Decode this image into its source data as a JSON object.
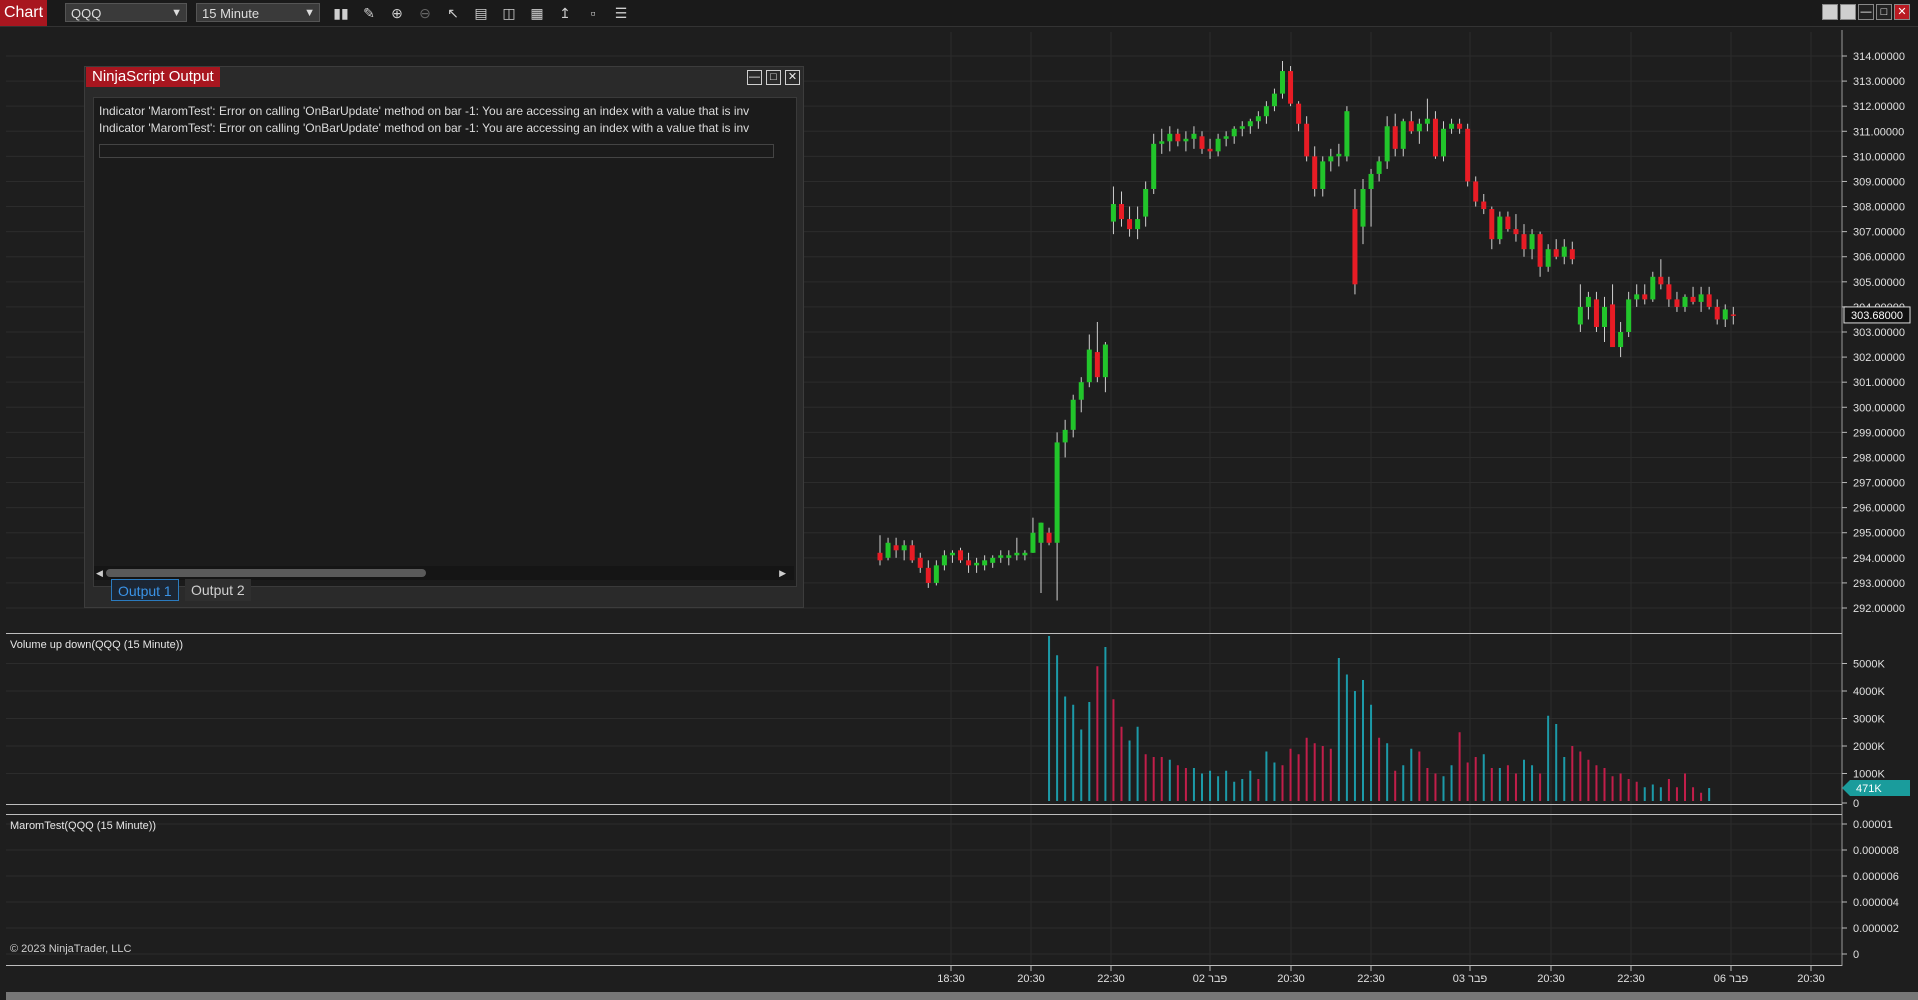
{
  "toolbar": {
    "chart_label": "Chart",
    "instrument": "QQQ",
    "interval": "15 Minute"
  },
  "colors": {
    "accent_red": "#a8161f",
    "candle_up": "#22c52b",
    "candle_down": "#e81c25",
    "volume_up": "#1c9aa8",
    "volume_down": "#c21e4a",
    "grid": "#2c2c2c",
    "background": "#1e1e1e"
  },
  "ninjascript": {
    "title": "NinjaScript Output",
    "lines": [
      "Indicator 'MaromTest': Error on calling 'OnBarUpdate' method on bar -1: You are accessing an index with a value that is invali",
      "Indicator 'MaromTest': Error on calling 'OnBarUpdate' method on bar -1: You are accessing an index with a value that is invali"
    ],
    "tabs": [
      {
        "label": "Output 1",
        "active": true
      },
      {
        "label": "Output 2",
        "active": false
      }
    ]
  },
  "panels": {
    "volume_label": "Volume up down(QQQ (15 Minute))",
    "indicator_label": "MaromTest(QQQ (15 Minute))",
    "copyright": "© 2023 NinjaTrader, LLC"
  },
  "price_axis": {
    "ticks": [
      "314.00000",
      "313.00000",
      "312.00000",
      "311.00000",
      "310.00000",
      "309.00000",
      "308.00000",
      "307.00000",
      "306.00000",
      "305.00000",
      "304.00000",
      "303.00000",
      "302.00000",
      "301.00000",
      "300.00000",
      "299.00000",
      "298.00000",
      "297.00000",
      "296.00000",
      "295.00000",
      "294.00000",
      "293.00000",
      "292.00000"
    ],
    "current_price": "303.68000"
  },
  "volume_axis": {
    "ticks": [
      "5000K",
      "4000K",
      "3000K",
      "2000K",
      "1000K",
      "0"
    ],
    "current": "471K"
  },
  "indicator_axis": {
    "ticks": [
      "0.00001",
      "0.000008",
      "0.000006",
      "0.000004",
      "0.000002",
      "0"
    ]
  },
  "time_axis": {
    "labels": [
      "18:30",
      "20:30",
      "22:30",
      "02 פבר",
      "20:30",
      "22:30",
      "03 פבר",
      "20:30",
      "22:30",
      "06 פבר",
      "20:30"
    ]
  },
  "chart_data": {
    "type": "candlestick",
    "ylim": [
      291.5,
      314.5
    ],
    "candles": [
      {
        "o": 294.2,
        "h": 294.9,
        "l": 293.7,
        "c": 293.9
      },
      {
        "o": 294.0,
        "h": 294.8,
        "l": 293.9,
        "c": 294.6
      },
      {
        "o": 294.5,
        "h": 294.8,
        "l": 294.0,
        "c": 294.3
      },
      {
        "o": 294.3,
        "h": 294.7,
        "l": 293.9,
        "c": 294.5
      },
      {
        "o": 294.5,
        "h": 294.7,
        "l": 293.8,
        "c": 293.9
      },
      {
        "o": 294.0,
        "h": 294.2,
        "l": 293.4,
        "c": 293.6
      },
      {
        "o": 293.6,
        "h": 293.9,
        "l": 292.8,
        "c": 293.0
      },
      {
        "o": 293.0,
        "h": 293.9,
        "l": 292.9,
        "c": 293.7
      },
      {
        "o": 293.7,
        "h": 294.3,
        "l": 293.5,
        "c": 294.1
      },
      {
        "o": 294.1,
        "h": 294.3,
        "l": 293.8,
        "c": 294.2
      },
      {
        "o": 294.3,
        "h": 294.4,
        "l": 293.8,
        "c": 293.9
      },
      {
        "o": 293.9,
        "h": 294.2,
        "l": 293.4,
        "c": 293.7
      },
      {
        "o": 293.7,
        "h": 294.0,
        "l": 293.4,
        "c": 293.8
      },
      {
        "o": 293.7,
        "h": 294.1,
        "l": 293.5,
        "c": 293.9
      },
      {
        "o": 293.8,
        "h": 294.1,
        "l": 293.6,
        "c": 294.0
      },
      {
        "o": 294.0,
        "h": 294.3,
        "l": 293.8,
        "c": 294.1
      },
      {
        "o": 294.0,
        "h": 294.3,
        "l": 293.7,
        "c": 294.1
      },
      {
        "o": 294.1,
        "h": 294.8,
        "l": 293.9,
        "c": 294.2
      },
      {
        "o": 294.1,
        "h": 294.3,
        "l": 293.9,
        "c": 294.2
      },
      {
        "o": 294.2,
        "h": 295.6,
        "l": 294.2,
        "c": 295.0
      },
      {
        "o": 294.6,
        "h": 295.4,
        "l": 292.6,
        "c": 295.4
      },
      {
        "o": 295.0,
        "h": 295.2,
        "l": 294.5,
        "c": 294.6
      },
      {
        "o": 294.6,
        "h": 299.0,
        "l": 292.3,
        "c": 298.6
      },
      {
        "o": 298.6,
        "h": 299.5,
        "l": 298.0,
        "c": 299.1
      },
      {
        "o": 299.1,
        "h": 300.5,
        "l": 298.8,
        "c": 300.3
      },
      {
        "o": 300.3,
        "h": 301.2,
        "l": 299.8,
        "c": 301.0
      },
      {
        "o": 301.0,
        "h": 302.9,
        "l": 300.8,
        "c": 302.3
      },
      {
        "o": 302.2,
        "h": 303.4,
        "l": 301.0,
        "c": 301.2
      },
      {
        "o": 301.2,
        "h": 302.6,
        "l": 300.6,
        "c": 302.5
      },
      {
        "o": 307.4,
        "h": 308.8,
        "l": 306.9,
        "c": 308.1
      },
      {
        "o": 308.1,
        "h": 308.6,
        "l": 307.2,
        "c": 307.5
      },
      {
        "o": 307.5,
        "h": 308.0,
        "l": 306.8,
        "c": 307.1
      },
      {
        "o": 307.1,
        "h": 308.0,
        "l": 306.7,
        "c": 307.5
      },
      {
        "o": 307.6,
        "h": 309.0,
        "l": 307.2,
        "c": 308.7
      },
      {
        "o": 308.7,
        "h": 310.9,
        "l": 308.5,
        "c": 310.5
      },
      {
        "o": 310.5,
        "h": 311.1,
        "l": 310.1,
        "c": 310.6
      },
      {
        "o": 310.6,
        "h": 311.2,
        "l": 310.2,
        "c": 310.9
      },
      {
        "o": 310.9,
        "h": 311.1,
        "l": 310.4,
        "c": 310.6
      },
      {
        "o": 310.6,
        "h": 311.0,
        "l": 310.2,
        "c": 310.7
      },
      {
        "o": 310.7,
        "h": 311.2,
        "l": 310.3,
        "c": 310.9
      },
      {
        "o": 310.8,
        "h": 311.0,
        "l": 310.1,
        "c": 310.3
      },
      {
        "o": 310.3,
        "h": 310.7,
        "l": 309.9,
        "c": 310.2
      },
      {
        "o": 310.2,
        "h": 310.9,
        "l": 310.0,
        "c": 310.7
      },
      {
        "o": 310.7,
        "h": 311.0,
        "l": 310.4,
        "c": 310.8
      },
      {
        "o": 310.8,
        "h": 311.2,
        "l": 310.5,
        "c": 311.1
      },
      {
        "o": 311.1,
        "h": 311.4,
        "l": 310.8,
        "c": 311.2
      },
      {
        "o": 311.2,
        "h": 311.5,
        "l": 310.9,
        "c": 311.4
      },
      {
        "o": 311.4,
        "h": 311.8,
        "l": 311.1,
        "c": 311.6
      },
      {
        "o": 311.6,
        "h": 312.2,
        "l": 311.3,
        "c": 312.0
      },
      {
        "o": 312.0,
        "h": 312.7,
        "l": 311.8,
        "c": 312.5
      },
      {
        "o": 312.5,
        "h": 313.8,
        "l": 312.3,
        "c": 313.4
      },
      {
        "o": 313.4,
        "h": 313.6,
        "l": 312.0,
        "c": 312.1
      },
      {
        "o": 312.1,
        "h": 312.2,
        "l": 311.0,
        "c": 311.3
      },
      {
        "o": 311.3,
        "h": 311.6,
        "l": 309.8,
        "c": 310.0
      },
      {
        "o": 310.0,
        "h": 310.4,
        "l": 308.4,
        "c": 308.7
      },
      {
        "o": 308.7,
        "h": 310.0,
        "l": 308.4,
        "c": 309.8
      },
      {
        "o": 309.8,
        "h": 310.3,
        "l": 309.4,
        "c": 310.0
      },
      {
        "o": 310.0,
        "h": 310.5,
        "l": 309.6,
        "c": 310.1
      },
      {
        "o": 310.0,
        "h": 312.0,
        "l": 309.8,
        "c": 311.8
      },
      {
        "o": 307.9,
        "h": 308.7,
        "l": 304.5,
        "c": 304.9
      },
      {
        "o": 307.2,
        "h": 309.1,
        "l": 306.5,
        "c": 308.7
      },
      {
        "o": 308.7,
        "h": 309.5,
        "l": 307.2,
        "c": 309.3
      },
      {
        "o": 309.3,
        "h": 310.0,
        "l": 309.0,
        "c": 309.8
      },
      {
        "o": 309.8,
        "h": 311.6,
        "l": 309.5,
        "c": 311.2
      },
      {
        "o": 311.2,
        "h": 311.7,
        "l": 310.0,
        "c": 310.3
      },
      {
        "o": 310.3,
        "h": 311.5,
        "l": 310.0,
        "c": 311.4
      },
      {
        "o": 311.4,
        "h": 311.8,
        "l": 310.9,
        "c": 311.0
      },
      {
        "o": 311.0,
        "h": 311.5,
        "l": 310.5,
        "c": 311.3
      },
      {
        "o": 311.3,
        "h": 312.3,
        "l": 311.0,
        "c": 311.5
      },
      {
        "o": 311.5,
        "h": 311.8,
        "l": 309.9,
        "c": 310.0
      },
      {
        "o": 310.0,
        "h": 311.4,
        "l": 309.8,
        "c": 311.1
      },
      {
        "o": 311.1,
        "h": 311.5,
        "l": 310.9,
        "c": 311.3
      },
      {
        "o": 311.3,
        "h": 311.5,
        "l": 310.9,
        "c": 311.1
      },
      {
        "o": 311.1,
        "h": 311.3,
        "l": 308.8,
        "c": 309.0
      },
      {
        "o": 309.0,
        "h": 309.2,
        "l": 308.0,
        "c": 308.2
      },
      {
        "o": 308.2,
        "h": 308.5,
        "l": 307.7,
        "c": 307.9
      },
      {
        "o": 307.9,
        "h": 308.0,
        "l": 306.3,
        "c": 306.7
      },
      {
        "o": 306.7,
        "h": 307.8,
        "l": 306.5,
        "c": 307.6
      },
      {
        "o": 307.6,
        "h": 307.8,
        "l": 307.0,
        "c": 307.1
      },
      {
        "o": 307.1,
        "h": 307.7,
        "l": 306.6,
        "c": 306.9
      },
      {
        "o": 306.9,
        "h": 307.3,
        "l": 306.0,
        "c": 306.3
      },
      {
        "o": 306.3,
        "h": 307.1,
        "l": 305.9,
        "c": 306.9
      },
      {
        "o": 306.9,
        "h": 307.0,
        "l": 305.2,
        "c": 305.6
      },
      {
        "o": 305.6,
        "h": 306.5,
        "l": 305.4,
        "c": 306.3
      },
      {
        "o": 306.3,
        "h": 306.7,
        "l": 305.9,
        "c": 306.0
      },
      {
        "o": 306.0,
        "h": 306.7,
        "l": 305.7,
        "c": 306.4
      },
      {
        "o": 306.3,
        "h": 306.6,
        "l": 305.7,
        "c": 305.9
      },
      {
        "o": 303.3,
        "h": 304.9,
        "l": 303.0,
        "c": 304.0
      },
      {
        "o": 304.0,
        "h": 304.6,
        "l": 303.5,
        "c": 304.4
      },
      {
        "o": 304.3,
        "h": 304.6,
        "l": 303.0,
        "c": 303.2
      },
      {
        "o": 303.2,
        "h": 304.4,
        "l": 302.6,
        "c": 304.0
      },
      {
        "o": 304.1,
        "h": 304.9,
        "l": 302.6,
        "c": 302.4
      },
      {
        "o": 302.4,
        "h": 303.4,
        "l": 302.0,
        "c": 303.0
      },
      {
        "o": 303.0,
        "h": 304.6,
        "l": 302.8,
        "c": 304.3
      },
      {
        "o": 304.3,
        "h": 304.9,
        "l": 304.0,
        "c": 304.5
      },
      {
        "o": 304.5,
        "h": 304.9,
        "l": 304.1,
        "c": 304.3
      },
      {
        "o": 304.3,
        "h": 305.4,
        "l": 304.2,
        "c": 305.2
      },
      {
        "o": 305.2,
        "h": 305.9,
        "l": 304.7,
        "c": 304.9
      },
      {
        "o": 304.9,
        "h": 305.2,
        "l": 304.0,
        "c": 304.3
      },
      {
        "o": 304.3,
        "h": 304.6,
        "l": 303.8,
        "c": 304.0
      },
      {
        "o": 304.0,
        "h": 304.5,
        "l": 303.8,
        "c": 304.4
      },
      {
        "o": 304.4,
        "h": 304.8,
        "l": 304.1,
        "c": 304.2
      },
      {
        "o": 304.2,
        "h": 304.8,
        "l": 303.8,
        "c": 304.5
      },
      {
        "o": 304.5,
        "h": 304.8,
        "l": 303.9,
        "c": 304.0
      },
      {
        "o": 304.0,
        "h": 304.3,
        "l": 303.3,
        "c": 303.5
      },
      {
        "o": 303.5,
        "h": 304.1,
        "l": 303.2,
        "c": 303.9
      },
      {
        "o": 303.7,
        "h": 304.0,
        "l": 303.3,
        "c": 303.68
      }
    ],
    "volume": {
      "ylim": [
        0,
        6000
      ],
      "start_index": 19,
      "bars": [
        {
          "v": 6000,
          "up": true
        },
        {
          "v": 5300,
          "up": true
        },
        {
          "v": 3800,
          "up": true
        },
        {
          "v": 3500,
          "up": true
        },
        {
          "v": 2600,
          "up": true
        },
        {
          "v": 3600,
          "up": true
        },
        {
          "v": 4900,
          "up": false
        },
        {
          "v": 5600,
          "up": true
        },
        {
          "v": 3700,
          "up": false
        },
        {
          "v": 2700,
          "up": false
        },
        {
          "v": 2200,
          "up": true
        },
        {
          "v": 2700,
          "up": true
        },
        {
          "v": 1700,
          "up": false
        },
        {
          "v": 1600,
          "up": false
        },
        {
          "v": 1600,
          "up": false
        },
        {
          "v": 1500,
          "up": true
        },
        {
          "v": 1300,
          "up": false
        },
        {
          "v": 1200,
          "up": false
        },
        {
          "v": 1200,
          "up": true
        },
        {
          "v": 1000,
          "up": true
        },
        {
          "v": 1100,
          "up": true
        },
        {
          "v": 900,
          "up": true
        },
        {
          "v": 1100,
          "up": true
        },
        {
          "v": 700,
          "up": true
        },
        {
          "v": 800,
          "up": true
        },
        {
          "v": 1100,
          "up": true
        },
        {
          "v": 800,
          "up": false
        },
        {
          "v": 1800,
          "up": true
        },
        {
          "v": 1400,
          "up": true
        },
        {
          "v": 1300,
          "up": false
        },
        {
          "v": 1900,
          "up": false
        },
        {
          "v": 1700,
          "up": false
        },
        {
          "v": 2300,
          "up": false
        },
        {
          "v": 2100,
          "up": false
        },
        {
          "v": 2000,
          "up": false
        },
        {
          "v": 1900,
          "up": false
        },
        {
          "v": 5200,
          "up": true
        },
        {
          "v": 4600,
          "up": true
        },
        {
          "v": 4000,
          "up": true
        },
        {
          "v": 4400,
          "up": true
        },
        {
          "v": 3500,
          "up": true
        },
        {
          "v": 2300,
          "up": false
        },
        {
          "v": 2100,
          "up": true
        },
        {
          "v": 1100,
          "up": false
        },
        {
          "v": 1300,
          "up": true
        },
        {
          "v": 1900,
          "up": true
        },
        {
          "v": 1800,
          "up": false
        },
        {
          "v": 1200,
          "up": false
        },
        {
          "v": 1000,
          "up": false
        },
        {
          "v": 900,
          "up": true
        },
        {
          "v": 1300,
          "up": true
        },
        {
          "v": 2500,
          "up": false
        },
        {
          "v": 1400,
          "up": false
        },
        {
          "v": 1600,
          "up": false
        },
        {
          "v": 1700,
          "up": true
        },
        {
          "v": 1200,
          "up": false
        },
        {
          "v": 1200,
          "up": true
        },
        {
          "v": 1300,
          "up": false
        },
        {
          "v": 1000,
          "up": false
        },
        {
          "v": 1500,
          "up": true
        },
        {
          "v": 1300,
          "up": true
        },
        {
          "v": 1000,
          "up": false
        },
        {
          "v": 3100,
          "up": true
        },
        {
          "v": 2800,
          "up": true
        },
        {
          "v": 1600,
          "up": true
        },
        {
          "v": 2000,
          "up": false
        },
        {
          "v": 1800,
          "up": false
        },
        {
          "v": 1500,
          "up": false
        },
        {
          "v": 1300,
          "up": false
        },
        {
          "v": 1200,
          "up": false
        },
        {
          "v": 900,
          "up": false
        },
        {
          "v": 1000,
          "up": false
        },
        {
          "v": 800,
          "up": false
        },
        {
          "v": 700,
          "up": false
        },
        {
          "v": 500,
          "up": true
        },
        {
          "v": 600,
          "up": true
        },
        {
          "v": 500,
          "up": true
        },
        {
          "v": 800,
          "up": false
        },
        {
          "v": 500,
          "up": false
        },
        {
          "v": 1000,
          "up": false
        },
        {
          "v": 500,
          "up": false
        },
        {
          "v": 300,
          "up": false
        },
        {
          "v": 471,
          "up": true
        }
      ]
    }
  }
}
